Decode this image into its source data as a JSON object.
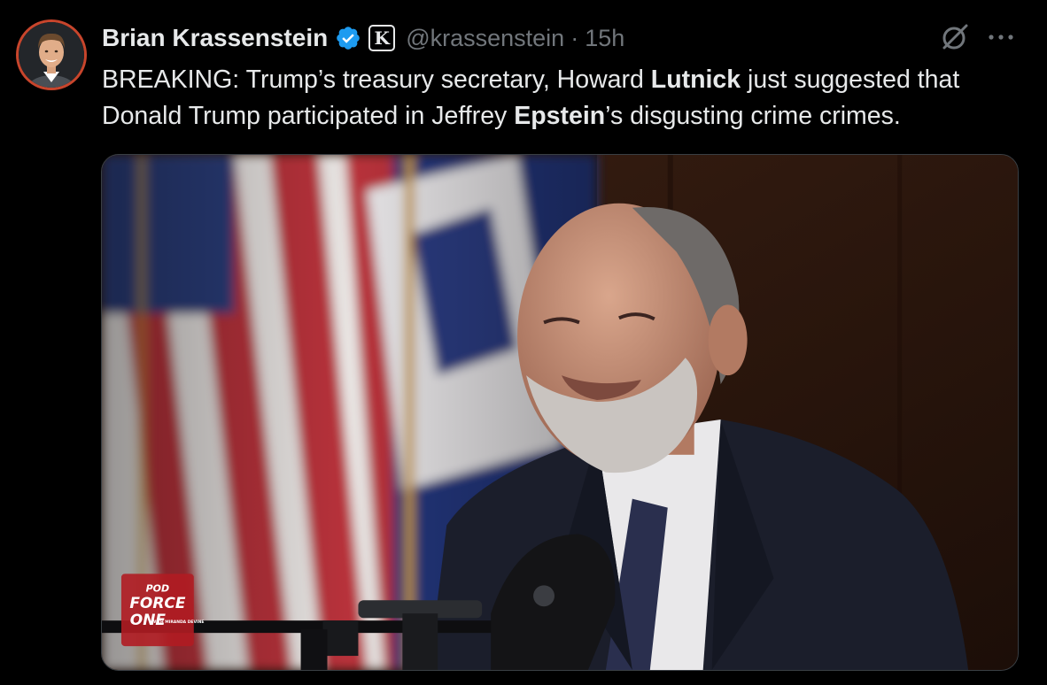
{
  "author": {
    "display_name": "Brian Krassenstein",
    "handle": "@krassenstein",
    "separator": "·",
    "timestamp": "15h",
    "verified": true,
    "affiliate_badge_letter": "K"
  },
  "tweet": {
    "text_parts": [
      {
        "text": "BREAKING: Trump’s treasury secretary, Howard ",
        "bold": false
      },
      {
        "text": "Lutnick",
        "bold": true
      },
      {
        "text": " just suggested that Donald Trump participated in Jeffrey ",
        "bold": false
      },
      {
        "text": "Epstein",
        "bold": true
      },
      {
        "text": "’s disgusting crime crimes.",
        "bold": false
      }
    ]
  },
  "media": {
    "type": "video",
    "watermark": {
      "line1": "POD",
      "line2": "FORCE",
      "line3": "ONE",
      "small": "WITH MIRANDA DEVINE"
    }
  },
  "icons": {
    "avatar": "avatar",
    "verified": "verified-badge-icon",
    "grok": "grok-icon",
    "more": "more-options-icon"
  },
  "colors": {
    "background": "#000000",
    "text_primary": "#e7e9ea",
    "text_secondary": "#71767b",
    "verified_blue": "#1d9bf0",
    "avatar_ring": "#c8452c"
  }
}
